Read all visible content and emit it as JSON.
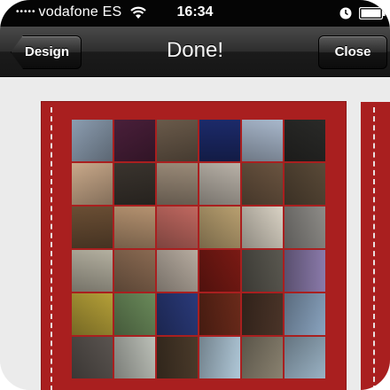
{
  "status_bar": {
    "signal_dots": "•••••",
    "carrier": "vodafone ES",
    "time": "16:34",
    "icons": [
      "wifi-icon",
      "alarm-icon",
      "battery-icon"
    ]
  },
  "nav_bar": {
    "back_label": "Design",
    "title": "Done!",
    "close_label": "Close"
  },
  "collage": {
    "background_color": "#a91f1f",
    "columns": 6,
    "rows": 6,
    "photos": [
      [
        "#8c9db0",
        "#4a1f3a",
        "#6a5a4a",
        "#1c2a6a",
        "#a9b8cc",
        "#2a2a28"
      ],
      [
        "#c9a98a",
        "#3a342e",
        "#9a8a78",
        "#b9b2a8",
        "#6a5440",
        "#5a4a38"
      ],
      [
        "#6a4e34",
        "#b59270",
        "#c06860",
        "#b9a070",
        "#d9d2c4",
        "#8e8c88"
      ],
      [
        "#b4b0a0",
        "#8a6a52",
        "#b7aca0",
        "#7a1a14",
        "#5a5850",
        "#8a7aaa"
      ],
      [
        "#b5a038",
        "#6a8a5a",
        "#2a3a7a",
        "#6a2a1a",
        "#4a3428",
        "#8aa4c0"
      ],
      [
        "#5a5450",
        "#bcc0b8",
        "#4a3a2a",
        "#b0c8d8",
        "#8a8270",
        "#9ab2c4"
      ]
    ]
  }
}
